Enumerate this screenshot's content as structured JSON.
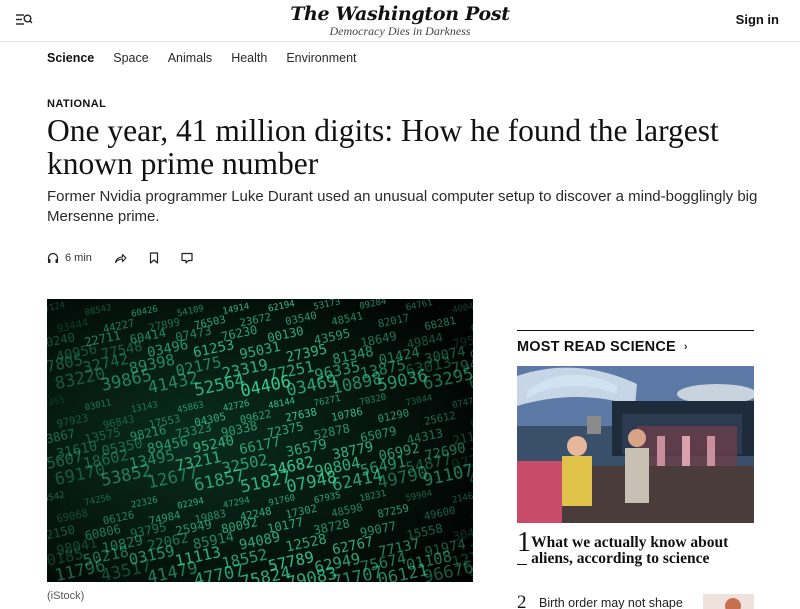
{
  "header": {
    "logo_title": "The Washington Post",
    "logo_tagline": "Democracy Dies in Darkness",
    "signin_label": "Sign in",
    "menu_icon": "menu-search-icon"
  },
  "section_nav": {
    "items": [
      {
        "label": "Science",
        "active": true
      },
      {
        "label": "Space",
        "active": false
      },
      {
        "label": "Animals",
        "active": false
      },
      {
        "label": "Health",
        "active": false
      },
      {
        "label": "Environment",
        "active": false
      }
    ]
  },
  "article": {
    "kicker": "NATIONAL",
    "headline": "One year, 41 million digits: How he found the largest known prime number",
    "dek": "Former Nvidia programmer Luke Durant used an unusual computer setup to discover a mind-bogglingly big Mersenne prime.",
    "listen_label": "6 min",
    "tool_icons": [
      "headphones-icon",
      "share-icon",
      "bookmark-icon",
      "comment-icon"
    ],
    "image_caption": "(iStock)"
  },
  "most_read": {
    "header": "MOST READ SCIENCE",
    "chevron": "›",
    "items": [
      {
        "rank": "1",
        "title": "What we actually know about aliens, according to science"
      },
      {
        "rank": "2",
        "title": "Birth order may not shape"
      }
    ]
  },
  "colors": {
    "accent_text": "#111111",
    "image_digits": "#3fe0a0",
    "image_bg": "#030806"
  }
}
